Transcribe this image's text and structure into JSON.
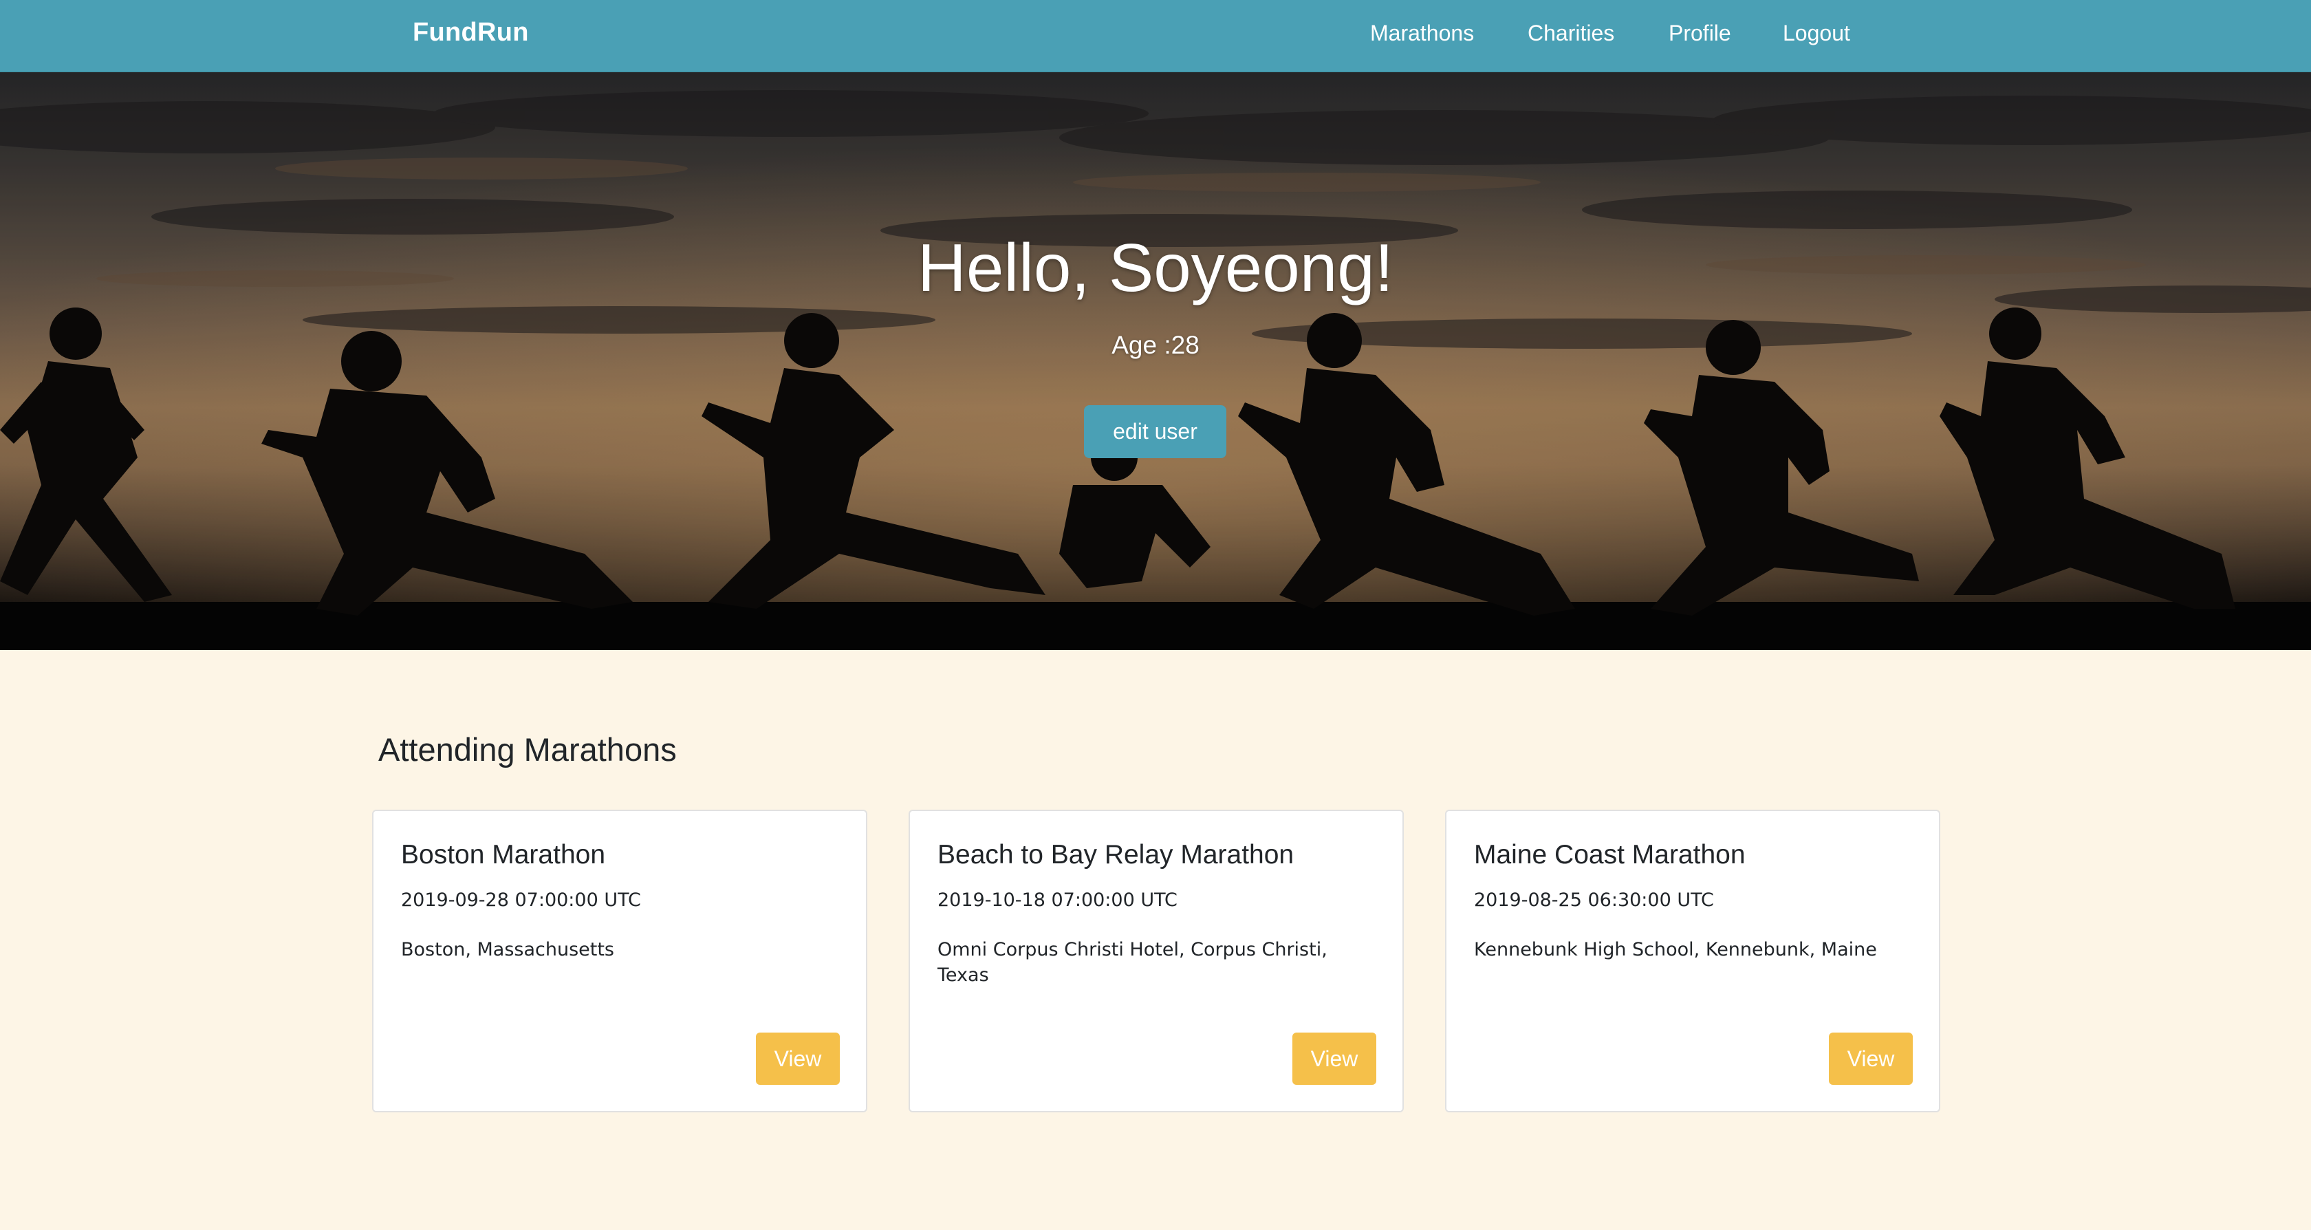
{
  "app": {
    "brand": "FundRun"
  },
  "nav": {
    "items": [
      {
        "label": "Marathons"
      },
      {
        "label": "Charities"
      },
      {
        "label": "Profile"
      },
      {
        "label": "Logout"
      }
    ]
  },
  "hero": {
    "greeting": "Hello, Soyeong!",
    "age_label": "Age :",
    "age_value": "28",
    "edit_button": "edit user"
  },
  "section": {
    "title": "Attending Marathons"
  },
  "marathons": [
    {
      "name": "Boston Marathon",
      "datetime": "2019-09-28 07:00:00 UTC",
      "location": "Boston, Massachusetts",
      "button": "View"
    },
    {
      "name": "Beach to Bay Relay Marathon",
      "datetime": "2019-10-18 07:00:00 UTC",
      "location": "Omni Corpus Christi Hotel, Corpus Christi, Texas",
      "button": "View"
    },
    {
      "name": "Maine Coast Marathon",
      "datetime": "2019-08-25 06:30:00 UTC",
      "location": "Kennebunk High School, Kennebunk, Maine",
      "button": "View"
    }
  ],
  "colors": {
    "navbar": "#4aa0b5",
    "primary_button": "#4aa0b5",
    "view_button": "#f5c04a",
    "page_background": "#fdf5e6"
  }
}
